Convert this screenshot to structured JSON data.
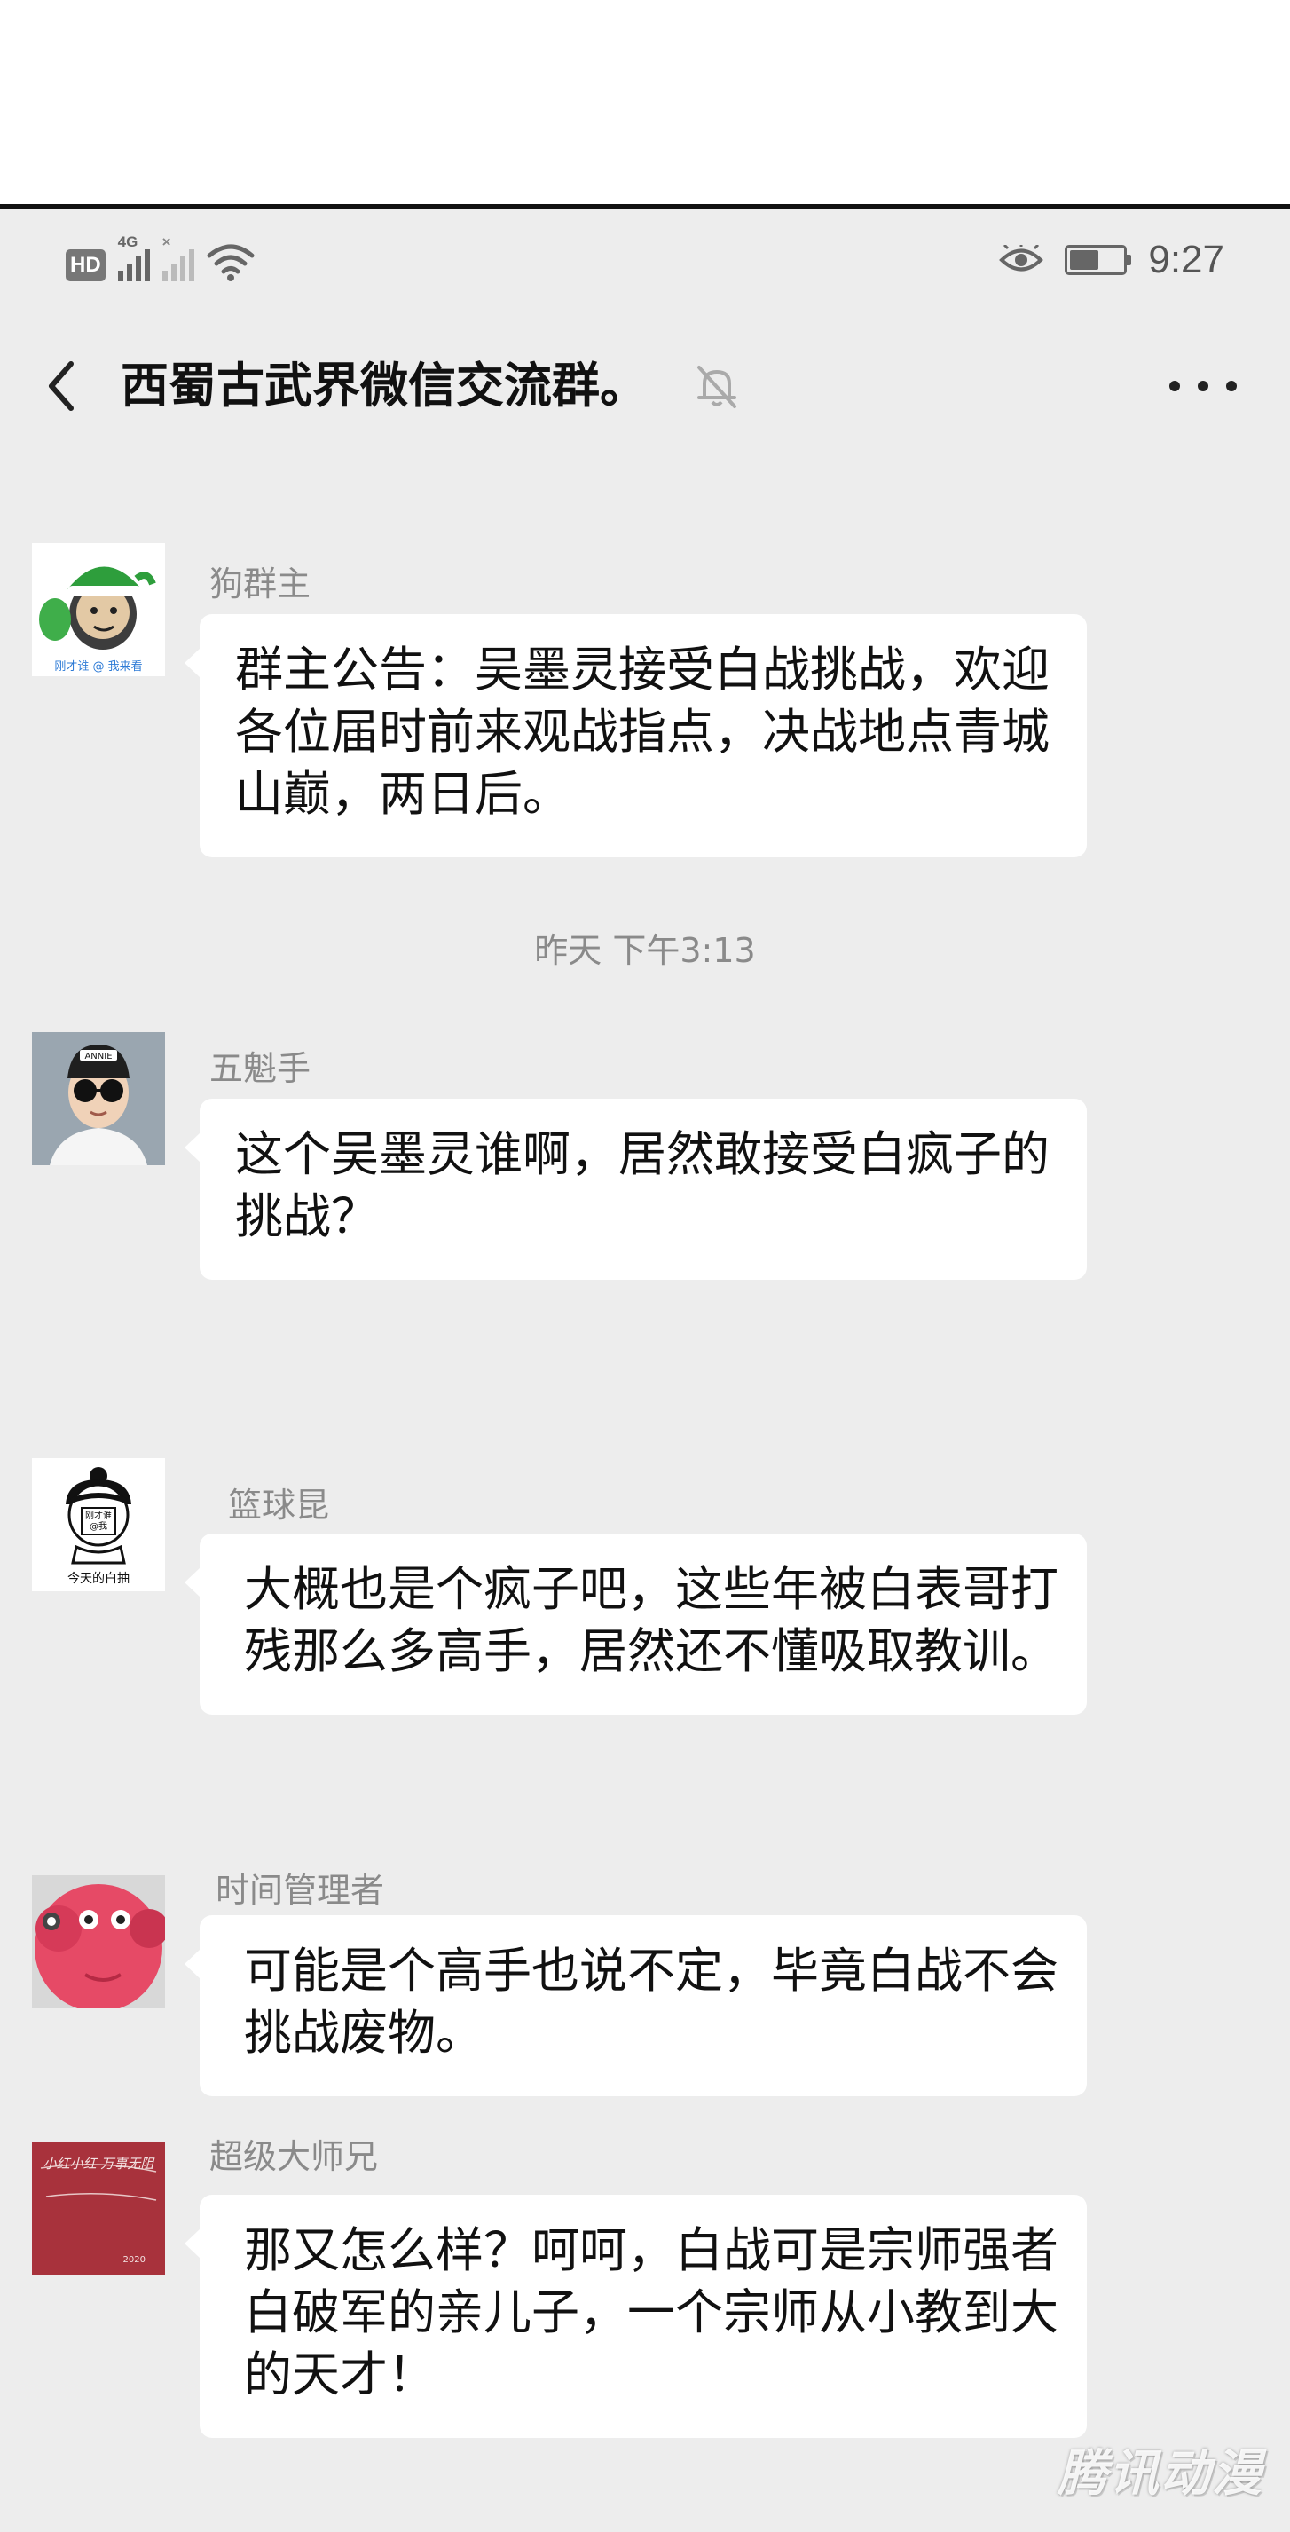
{
  "statusbar": {
    "hd": "HD",
    "network": "4G",
    "time": "9:27",
    "battery_level": 0.55,
    "icons": [
      "hd-icon",
      "signal-icon",
      "no-signal-icon",
      "wifi-icon",
      "eye-icon",
      "battery-icon"
    ]
  },
  "header": {
    "title": "西蜀古武界微信交流群。",
    "icons": [
      "back-arrow-icon",
      "mute-bell-icon",
      "more-icon"
    ]
  },
  "chat": {
    "timestamp": "昨天 下午3:13",
    "messages": [
      {
        "sender": "狗群主",
        "text": "群主公告：吴墨灵接受白战挑战，欢迎各位届时前来观战指点，决战地点青城山巅，两日后。",
        "avatar_caption": "刚才谁 @ 我来看"
      },
      {
        "sender": "五魁手",
        "text": "这个吴墨灵谁啊，居然敢接受白疯子的挑战？"
      },
      {
        "sender": "篮球昆",
        "text": "大概也是个疯子吧，这些年被白表哥打残那么多高手，居然还不懂吸取教训。",
        "avatar_caption": "今天的白抽"
      },
      {
        "sender": "时间管理者",
        "text": "可能是个高手也说不定，毕竟白战不会挑战废物。"
      },
      {
        "sender": "超级大师兄",
        "text": "那又怎么样？呵呵，白战可是宗师强者白破军的亲儿子，一个宗师从小教到大的天才！",
        "avatar_caption": "小红小红 万事无阻"
      }
    ]
  },
  "watermark": "腾讯动漫",
  "colors": {
    "background": "#ededed",
    "bubble": "#ffffff",
    "sender_text": "#8a8a8a"
  }
}
